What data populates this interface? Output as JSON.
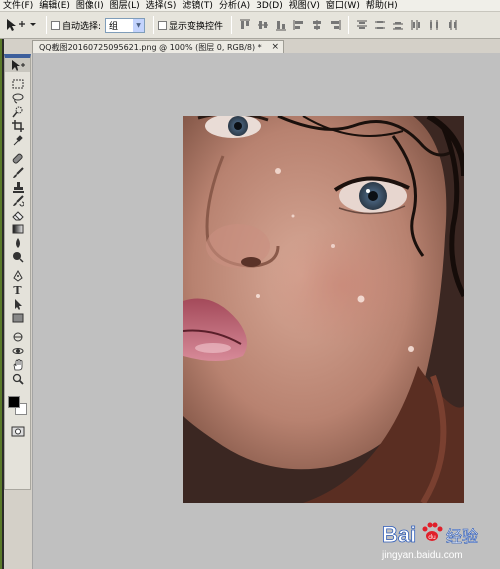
{
  "menubar": {
    "items": [
      "文件(F)",
      "编辑(E)",
      "图像(I)",
      "图层(L)",
      "选择(S)",
      "滤镜(T)",
      "分析(A)",
      "3D(D)",
      "视图(V)",
      "窗口(W)",
      "帮助(H)"
    ]
  },
  "options": {
    "auto_select_label": "自动选择:",
    "auto_select_value": "组",
    "show_transform_label": "显示变换控件"
  },
  "document": {
    "tab_title": "QQ截图20160725095621.png @ 100% (图层 0, RGB/8) *",
    "close_label": "×"
  },
  "toolbox": {
    "tools": [
      "move-tool",
      "marquee-tool",
      "lasso-tool",
      "quick-select-tool",
      "crop-tool",
      "eyedropper-tool",
      "healing-brush-tool",
      "brush-tool",
      "clone-stamp-tool",
      "history-brush-tool",
      "eraser-tool",
      "gradient-tool",
      "blur-tool",
      "dodge-tool",
      "pen-tool",
      "type-tool",
      "path-select-tool",
      "rectangle-tool",
      "3d-rotate-tool",
      "3d-orbit-tool",
      "hand-tool",
      "zoom-tool"
    ],
    "type_glyph": "T",
    "foreground_color": "#000000",
    "background_color": "#ffffff"
  },
  "watermark": {
    "brand": "Bai",
    "brand_suffix": "经验",
    "url": "jingyan.baidu.com"
  }
}
